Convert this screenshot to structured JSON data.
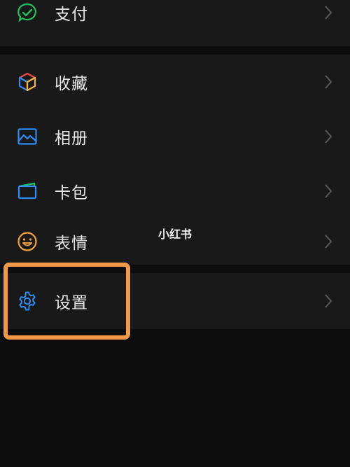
{
  "menu": {
    "pay": {
      "label": "支付",
      "icon": "pay-check-icon",
      "color": "#25c161"
    },
    "favorites": {
      "label": "收藏",
      "icon": "cube-icon"
    },
    "album": {
      "label": "相册",
      "icon": "image-icon",
      "color": "#2f8cf3"
    },
    "cards": {
      "label": "卡包",
      "icon": "card-wallet-icon",
      "color": "#2f8cf3"
    },
    "stickers": {
      "label": "表情",
      "icon": "smiley-icon",
      "color": "#f5a040"
    },
    "settings": {
      "label": "设置",
      "icon": "gear-icon",
      "color": "#2f8cf3"
    }
  },
  "watermark": {
    "text": "小红书"
  },
  "highlight_color": "#f29a4b"
}
